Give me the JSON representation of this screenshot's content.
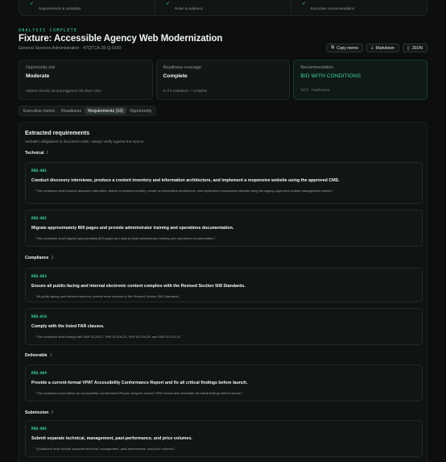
{
  "steps": [
    {
      "label": "Requirements & metadata"
    },
    {
      "label": "Rules & evidence"
    },
    {
      "label": "Executive recommendation"
    }
  ],
  "header": {
    "eyebrow": "ANALYSIS COMPLETE",
    "title": "Fixture: Accessible Agency Web Modernization",
    "subtitle": "General Services Administration · 47QTCA-26-Q-0142",
    "actions": {
      "copy": "Copy memo",
      "markdown": "Markdown",
      "json": "JSON"
    }
  },
  "cards": {
    "risk": {
      "label": "Opportunity risk",
      "value": "Moderate",
      "note": "Highest severity among triggered risk-driver rules"
    },
    "readiness": {
      "label": "Readiness coverage",
      "value": "Complete",
      "note": "8 of 8 evaluated — complete"
    },
    "recommendation": {
      "label": "Recommendation",
      "value": "BID WITH CONDITIONS",
      "note": "full readiness"
    }
  },
  "tabs": [
    "Executive memo",
    "Readiness",
    "Requirements (10)",
    "Opportunity"
  ],
  "panel": {
    "title": "Extracted requirements",
    "subtitle": "Verbatim obligations in document order. Always verify against the source."
  },
  "groups": [
    {
      "name": "Technical",
      "count": "2"
    },
    {
      "name": "Compliance",
      "count": "2"
    },
    {
      "name": "Deliverable",
      "count": "1"
    },
    {
      "name": "Submission",
      "count": "3"
    }
  ],
  "requirements": [
    {
      "id": "REQ-001",
      "text": "Conduct discovery interviews, produce a content inventory and information architecture, and implement a responsive website using the approved CMS.",
      "quote": "\"The contractor shall conduct discovery interviews, deliver a content inventory, create an information architecture, and implement a responsive website using the agency-approved content management system.\""
    },
    {
      "id": "REQ-002",
      "text": "Migrate approximately 800 pages and provide administrator training and operations documentation.",
      "quote": "\"The contractor shall migrate approximately 800 pages and shall provide administrator training and operations documentation.\""
    },
    {
      "id": "REQ-003",
      "text": "Ensure all public-facing and internal electronic content complies with the Revised Section 508 Standards.",
      "quote": "\"All public-facing and internal electronic content must conform to the Revised Section 508 Standards.\""
    },
    {
      "id": "REQ-010",
      "text": "Comply with the listed FAR clauses.",
      "quote": "\"The contractor shall comply with FAR 52.204-7, FAR 52.204-21, FAR 52.204-25, and FAR 52.219-14.\""
    },
    {
      "id": "REQ-004",
      "text": "Provide a current-format VPAT Accessibility Conformance Report and fix all critical findings before launch.",
      "quote": "\"The contractor must deliver an Accessibility Conformance Report using the current VPAT format and remediate all critical findings before launch.\""
    },
    {
      "id": "REQ-005",
      "text": "Submit separate technical, management, past-performance, and price volumes.",
      "quote": "\"Quotations must include separate technical, management, past-performance, and price volumes.\""
    }
  ]
}
